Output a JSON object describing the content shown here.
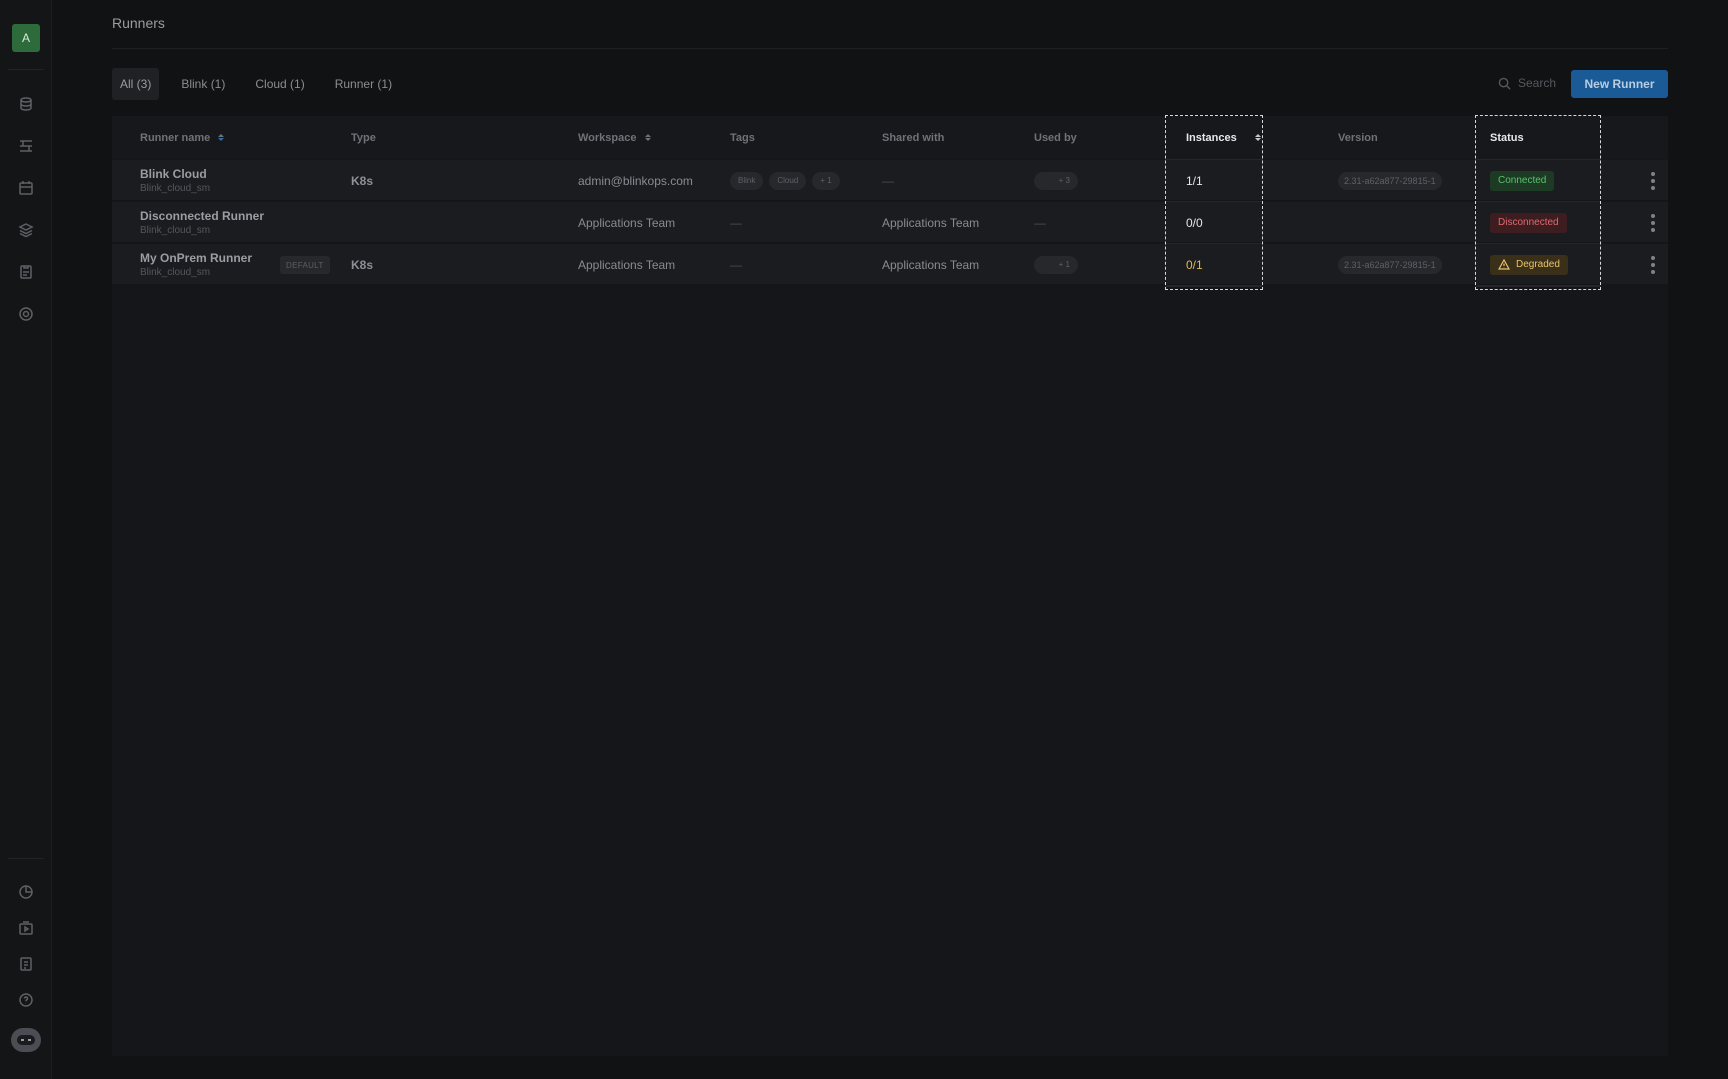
{
  "sidebar": {
    "avatar_letter": "A",
    "top_icons": [
      "database-icon",
      "flows-icon",
      "calendar-icon",
      "layers-icon",
      "clipboard-icon",
      "target-icon"
    ],
    "bottom_icons": [
      "pie-chart-icon",
      "play-box-icon",
      "cases-icon",
      "help-icon"
    ],
    "bot_icon": "assistant-bot-icon"
  },
  "page": {
    "title": "Runners"
  },
  "tabs": [
    {
      "label": "All (3)",
      "active": true
    },
    {
      "label": "Blink (1)",
      "active": false
    },
    {
      "label": "Cloud (1)",
      "active": false
    },
    {
      "label": "Runner (1)",
      "active": false
    }
  ],
  "search": {
    "placeholder": "Search"
  },
  "new_runner_label": "New Runner",
  "table": {
    "headers": {
      "runner_name": "Runner name",
      "type": "Type",
      "workspace": "Workspace",
      "tags": "Tags",
      "shared_with": "Shared with",
      "used_by": "Used by",
      "instances": "Instances",
      "version": "Version",
      "status": "Status"
    },
    "rows": [
      {
        "name": "Blink Cloud",
        "sub": "Blink_cloud_sm",
        "default_badge": "",
        "type": "K8s",
        "workspace": "admin@blinkops.com",
        "tags": [
          "Blink",
          "Cloud",
          "+ 1"
        ],
        "shared_with": "—",
        "used_by": "+ 3",
        "instances": "1/1",
        "version": "2.31-a62a877-29815-1",
        "status": "Connected"
      },
      {
        "name": "Disconnected Runner",
        "sub": "Blink_cloud_sm",
        "default_badge": "",
        "type": "",
        "workspace": "Applications Team",
        "tags_empty": "—",
        "shared_with": "Applications Team",
        "used_by_empty": "—",
        "instances": "0/0",
        "version": "",
        "status": "Disconnected"
      },
      {
        "name": "My OnPrem Runner",
        "sub": "Blink_cloud_sm",
        "default_badge": "DEFAULT",
        "type": "K8s",
        "workspace": "Applications Team",
        "tags_empty": "—",
        "shared_with": "Applications Team",
        "used_by": "+ 1",
        "instances": "0/1",
        "version": "2.31-a62a877-29815-1",
        "status": "Degraded"
      }
    ]
  },
  "colors": {
    "accent": "#1a5a96",
    "connected": "#59c46c",
    "disconnected": "#e06a6f",
    "degraded": "#e8c36a",
    "highlight_border": "#d8d8d8"
  }
}
